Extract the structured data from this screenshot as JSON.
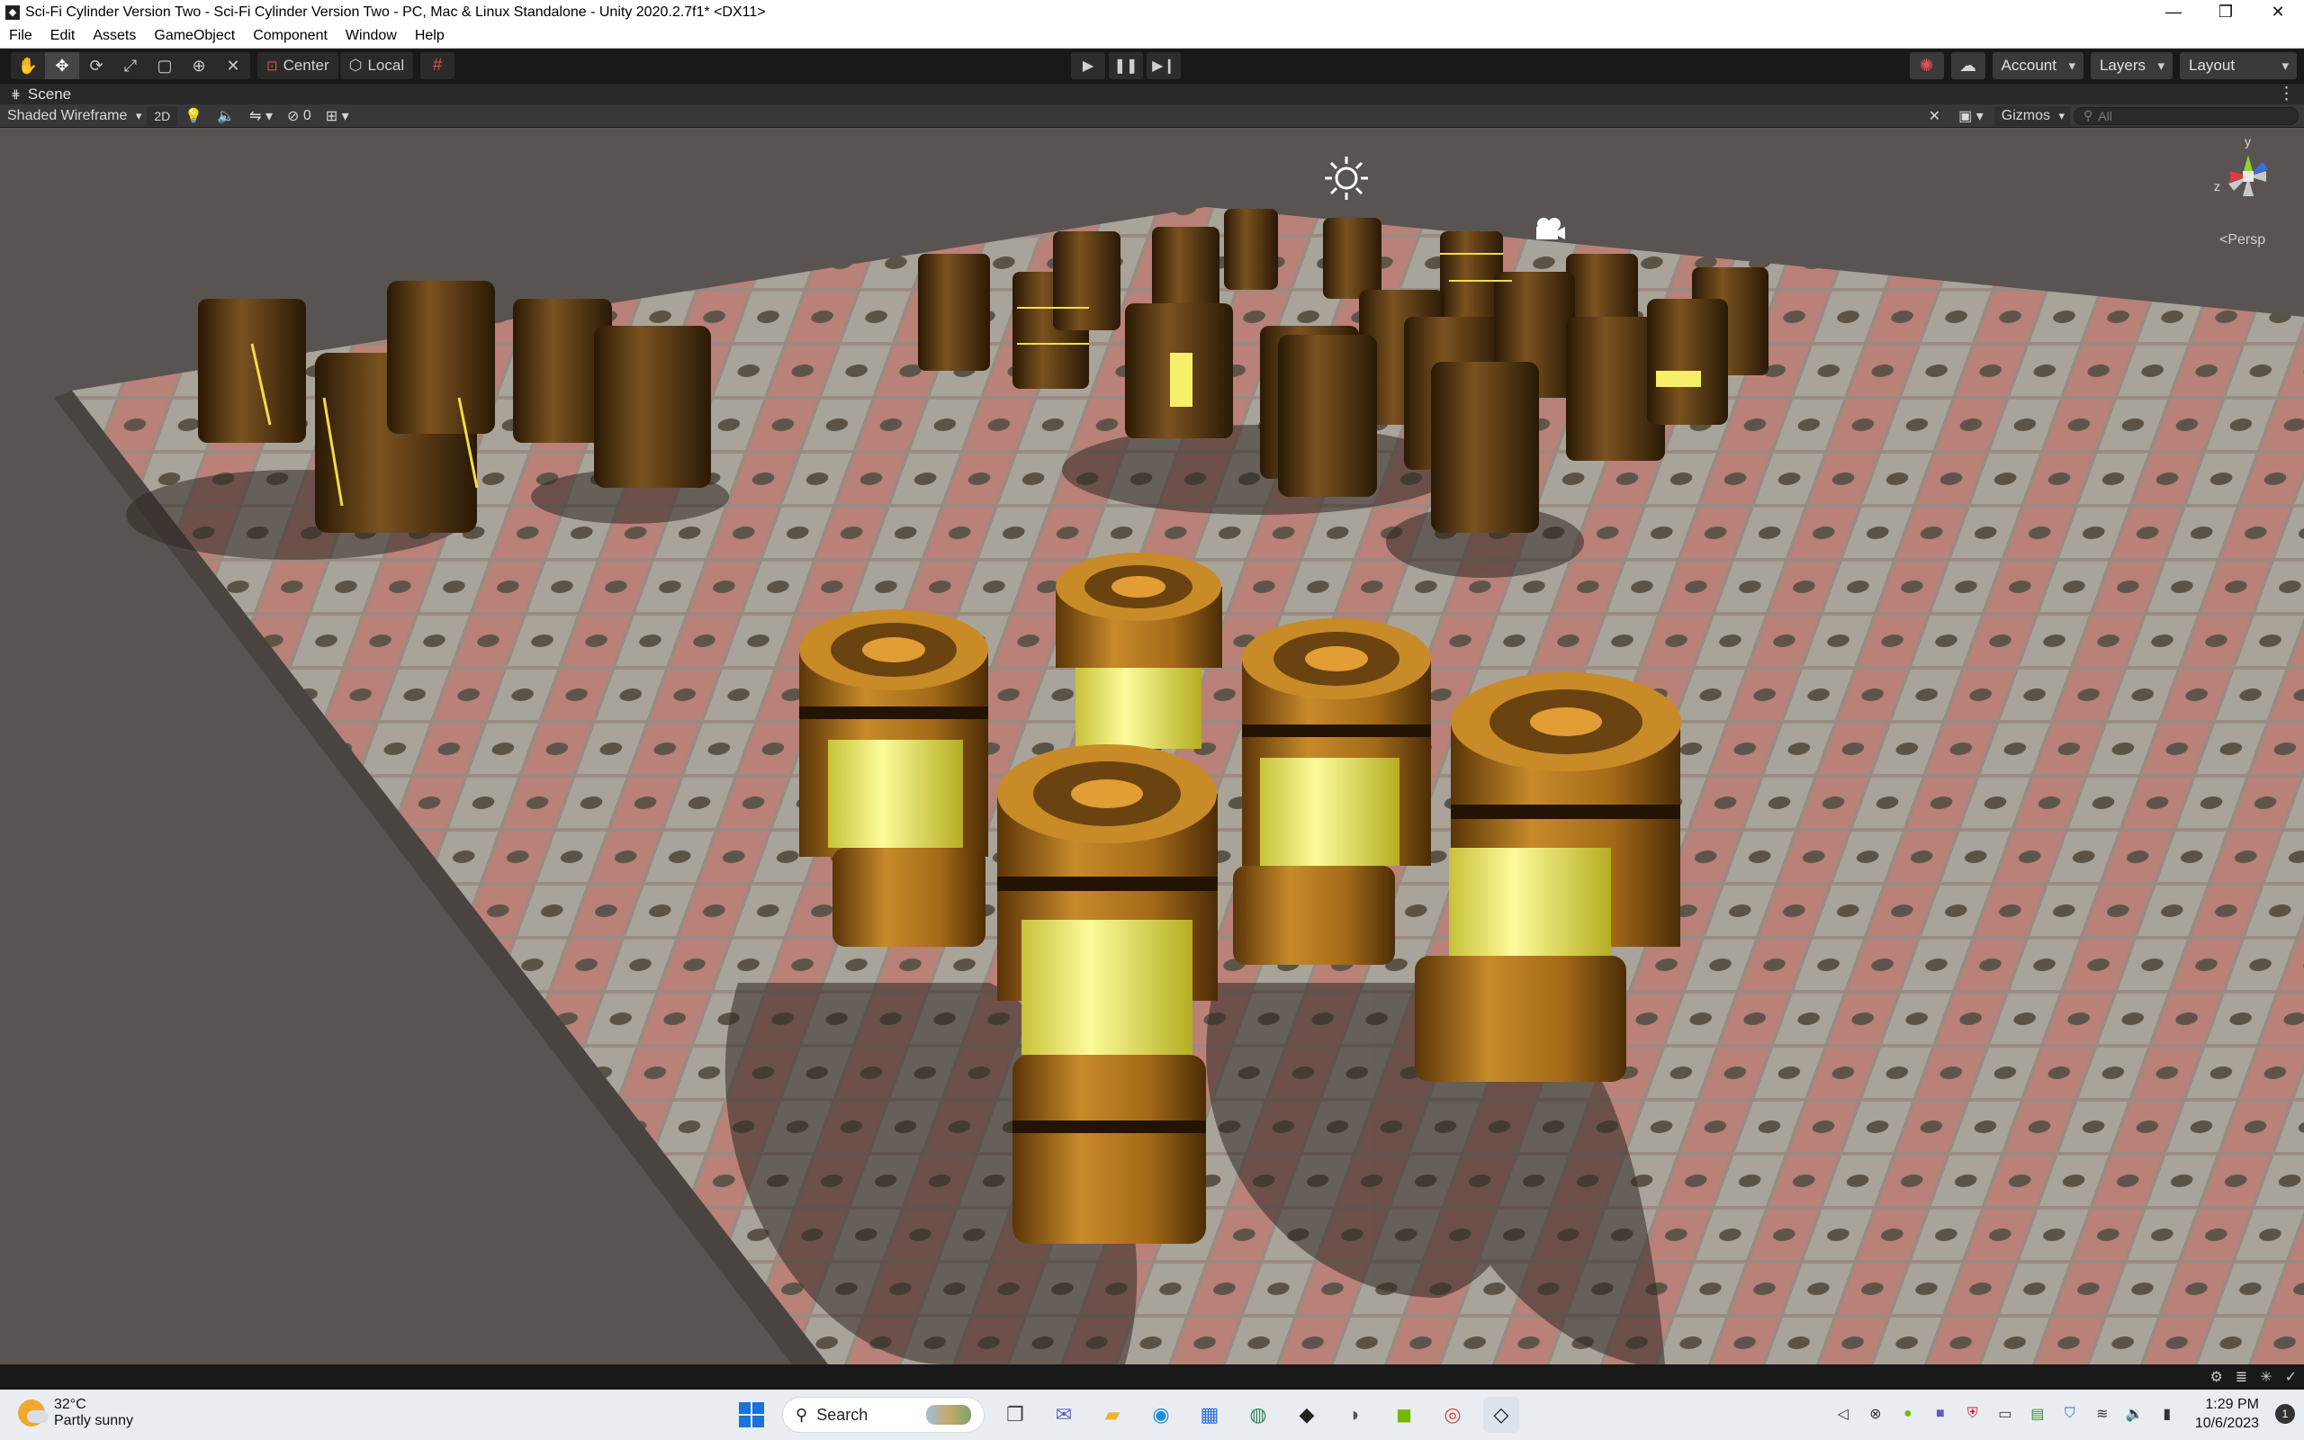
{
  "window": {
    "title": "Sci-Fi Cylinder Version Two - Sci-Fi Cylinder Version Two - PC, Mac & Linux Standalone - Unity 2020.2.7f1* <DX11>",
    "minimize": "—",
    "restore": "❒",
    "close": "✕"
  },
  "menu": [
    "File",
    "Edit",
    "Assets",
    "GameObject",
    "Component",
    "Window",
    "Help"
  ],
  "toolbar": {
    "pivot_center": "Center",
    "pivot_local": "Local",
    "account": "Account",
    "layers": "Layers",
    "layout": "Layout"
  },
  "scene": {
    "tab_label": "Scene",
    "shading_mode": "Shaded Wireframe",
    "btn_2d": "2D",
    "hidden_count": "0",
    "gizmos": "Gizmos",
    "search_placeholder": "All",
    "persp_label": "Persp",
    "axis_y": "y",
    "axis_z": "z"
  },
  "taskbar": {
    "temperature": "32°C",
    "weather": "Partly sunny",
    "search": "Search",
    "time": "1:29 PM",
    "date": "10/6/2023",
    "notifications": "1"
  }
}
